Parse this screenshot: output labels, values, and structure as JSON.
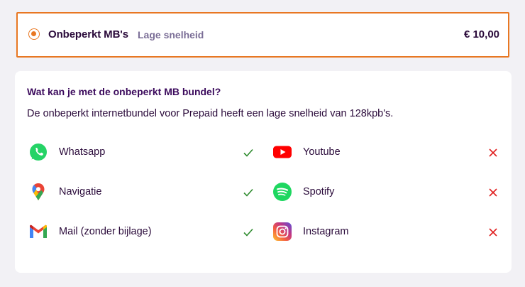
{
  "option": {
    "title": "Onbeperkt MB's",
    "subtitle": "Lage snelheid",
    "price": "€ 10,00",
    "selected": true,
    "accent_color": "#e87722"
  },
  "info": {
    "heading": "Wat kan je met de onbeperkt MB bundel?",
    "description": "De onbeperkt internetbundel voor Prepaid heeft een lage snelheid van 128kpb's."
  },
  "features_left": [
    {
      "label": "Whatsapp",
      "icon": "whatsapp-icon",
      "supported": true
    },
    {
      "label": "Navigatie",
      "icon": "google-maps-icon",
      "supported": true
    },
    {
      "label": "Mail (zonder bijlage)",
      "icon": "gmail-icon",
      "supported": true
    }
  ],
  "features_right": [
    {
      "label": "Youtube",
      "icon": "youtube-icon",
      "supported": false
    },
    {
      "label": "Spotify",
      "icon": "spotify-icon",
      "supported": false
    },
    {
      "label": "Instagram",
      "icon": "instagram-icon",
      "supported": false
    }
  ],
  "colors": {
    "check": "#2e8b2e",
    "cross": "#e02020",
    "panel_bg": "#ffffff",
    "page_bg": "#f2f1f5"
  }
}
